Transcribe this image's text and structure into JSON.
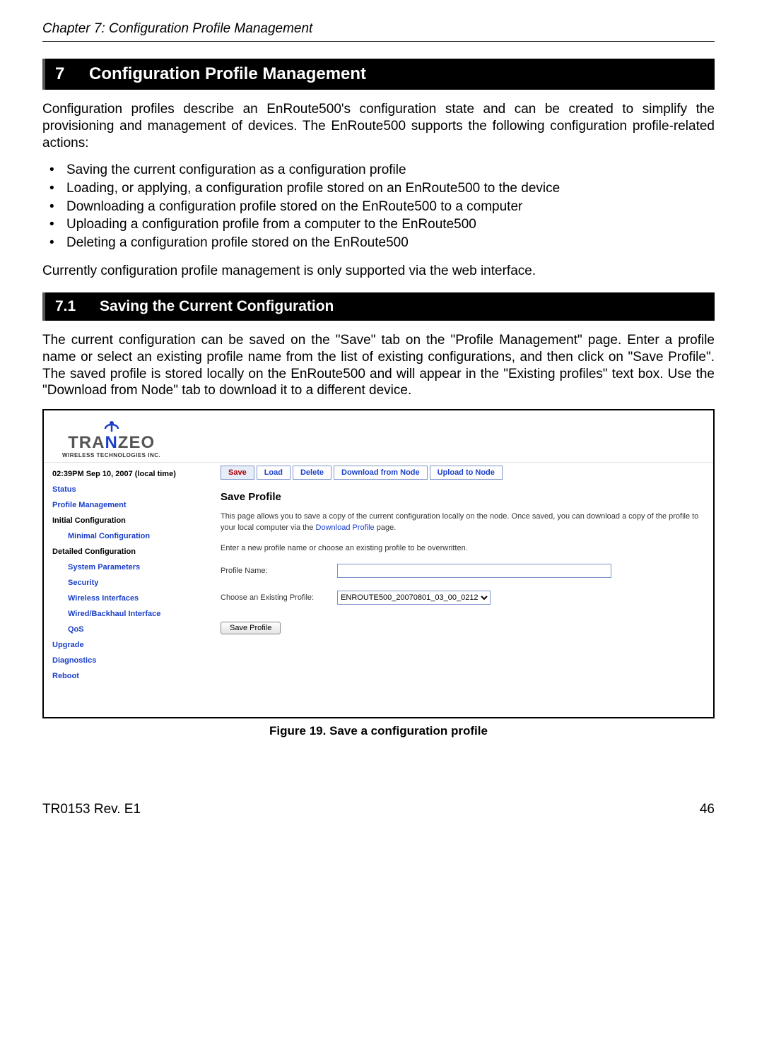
{
  "chapter_header": "Chapter 7: Configuration Profile Management",
  "section7": {
    "num": "7",
    "title": "Configuration Profile Management"
  },
  "intro": "Configuration profiles describe an EnRoute500's configuration state and can be created to simplify the provisioning and management of devices. The EnRoute500 supports the following configuration profile-related actions:",
  "bullets": [
    "Saving the current configuration as a configuration profile",
    "Loading, or applying, a configuration profile stored on an EnRoute500 to the device",
    "Downloading a configuration profile stored on the EnRoute500 to a computer",
    "Uploading a configuration profile from a computer to the EnRoute500",
    "Deleting a configuration profile stored on the EnRoute500"
  ],
  "closing": "Currently configuration profile management is only supported via the web interface.",
  "section71": {
    "num": "7.1",
    "title": "Saving the Current Configuration"
  },
  "para71": "The current configuration can be saved on the \"Save\" tab on the \"Profile Management\" page. Enter a profile name or select an existing profile name from the list of existing configurations, and then click on \"Save Profile\". The saved profile is stored locally on the EnRoute500 and will appear in the \"Existing profiles\" text box. Use the \"Download from Node\" tab to download it to a different device.",
  "figure": {
    "logo": {
      "line1_a": "TRA",
      "line1_b": "N",
      "line1_c": "ZEO",
      "line2": "WIRELESS TECHNOLOGIES INC."
    },
    "sidebar": {
      "time": "02:39PM Sep 10, 2007 (local time)",
      "items": [
        {
          "label": "Status",
          "sub": false
        },
        {
          "label": "Profile Management",
          "sub": false
        },
        {
          "label": "Initial Configuration",
          "sub": false,
          "heading": true
        },
        {
          "label": "Minimal Configuration",
          "sub": true
        },
        {
          "label": "Detailed Configuration",
          "sub": false,
          "heading": true
        },
        {
          "label": "System Parameters",
          "sub": true
        },
        {
          "label": "Security",
          "sub": true
        },
        {
          "label": "Wireless Interfaces",
          "sub": true
        },
        {
          "label": "Wired/Backhaul Interface",
          "sub": true
        },
        {
          "label": "QoS",
          "sub": true
        },
        {
          "label": "Upgrade",
          "sub": false
        },
        {
          "label": "Diagnostics",
          "sub": false
        },
        {
          "label": "Reboot",
          "sub": false
        }
      ]
    },
    "tabs": [
      "Save",
      "Load",
      "Delete",
      "Download from Node",
      "Upload to Node"
    ],
    "content": {
      "heading": "Save Profile",
      "p1a": "This page allows you to save a copy of the current configuration locally on the node. Once saved, you can download a copy of the profile to your local computer via the ",
      "p1link": "Download Profile",
      "p1b": " page.",
      "p2": "Enter a new profile name or choose an existing profile to be overwritten.",
      "label_name": "Profile Name:",
      "label_existing": "Choose an Existing Profile:",
      "select_value": "ENROUTE500_20070801_03_00_0212",
      "button": "Save Profile"
    },
    "caption": "Figure 19. Save a configuration profile"
  },
  "footer": {
    "left": "TR0153 Rev. E1",
    "right": "46"
  }
}
